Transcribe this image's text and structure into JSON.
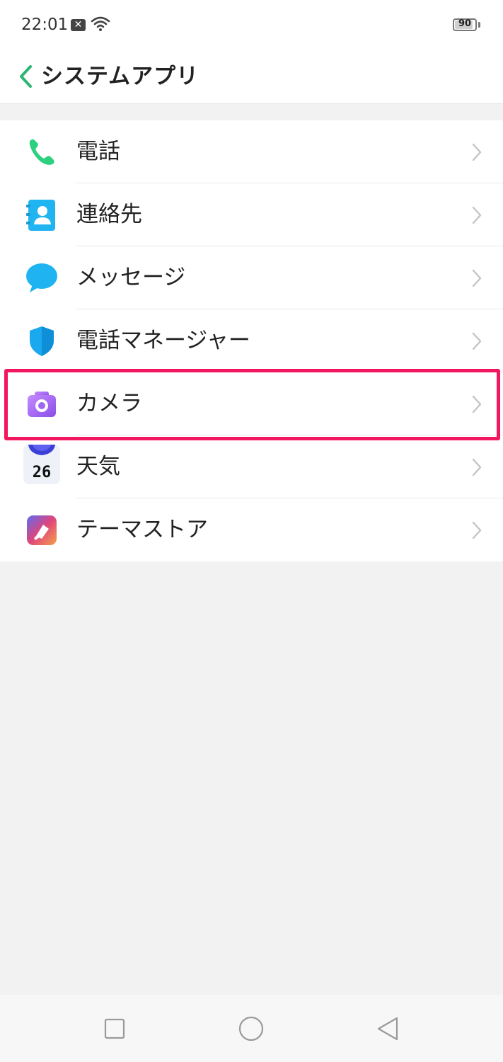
{
  "status": {
    "time": "22:01",
    "notification_icon": "x-box-icon",
    "battery_level": 90,
    "battery_text": "90"
  },
  "header": {
    "title": "システムアプリ",
    "back_icon": "chevron-left-icon"
  },
  "apps": [
    {
      "label": "電話",
      "icon": "phone-icon"
    },
    {
      "label": "連絡先",
      "icon": "contacts-icon"
    },
    {
      "label": "メッセージ",
      "icon": "message-bubble-icon"
    },
    {
      "label": "電話マネージャー",
      "icon": "shield-icon"
    },
    {
      "label": "カメラ",
      "icon": "camera-icon"
    },
    {
      "label": "天気",
      "icon": "weather-icon",
      "icon_text": "26"
    },
    {
      "label": "テーマストア",
      "icon": "theme-store-icon"
    }
  ],
  "highlighted_item": "カメラ",
  "colors": {
    "accent": "#2bb673",
    "highlight_border": "#f2185f",
    "background": "#f2f2f2"
  },
  "nav": {
    "recent_icon": "square-icon",
    "home_icon": "circle-icon",
    "back_icon": "triangle-left-icon"
  }
}
